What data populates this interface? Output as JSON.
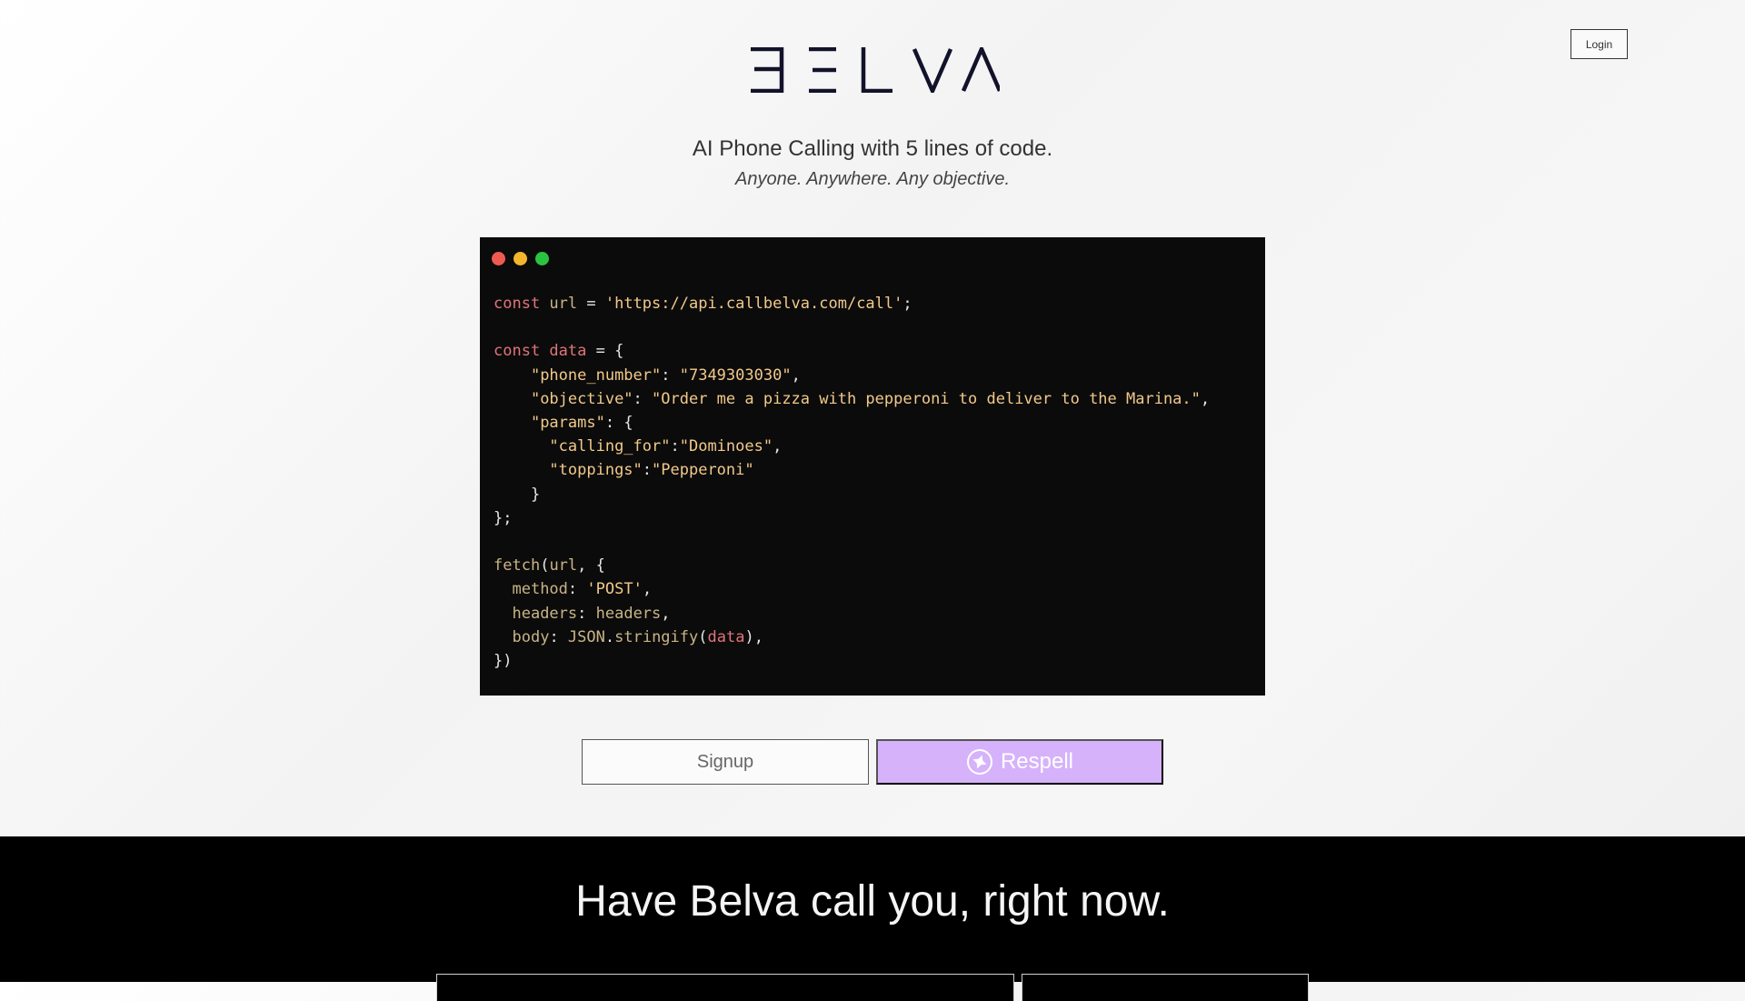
{
  "header": {
    "login_label": "Login",
    "brand": "BELVA"
  },
  "hero": {
    "tagline": "AI Phone Calling with 5 lines of code.",
    "subtagline": "Anyone. Anywhere. Any objective."
  },
  "code": {
    "lines": [
      [
        [
          "kw",
          "const "
        ],
        [
          "var",
          "url"
        ],
        [
          "pun",
          " = "
        ],
        [
          "str",
          "'https://api.callbelva.com/call'"
        ],
        [
          "pun",
          ";"
        ]
      ],
      [],
      [
        [
          "kw",
          "const "
        ],
        [
          "red",
          "data"
        ],
        [
          "pun",
          " = {"
        ]
      ],
      [
        [
          "pun",
          "    "
        ],
        [
          "str",
          "\"phone_number\""
        ],
        [
          "pun",
          ": "
        ],
        [
          "str",
          "\"7349303030\""
        ],
        [
          "pun",
          ","
        ]
      ],
      [
        [
          "pun",
          "    "
        ],
        [
          "str",
          "\"objective\""
        ],
        [
          "pun",
          ": "
        ],
        [
          "str",
          "\"Order me a pizza with pepperoni to deliver to the Marina.\""
        ],
        [
          "pun",
          ","
        ]
      ],
      [
        [
          "pun",
          "    "
        ],
        [
          "str",
          "\"params\""
        ],
        [
          "pun",
          ": {"
        ]
      ],
      [
        [
          "pun",
          "      "
        ],
        [
          "str",
          "\"calling_for\""
        ],
        [
          "pun",
          ":"
        ],
        [
          "str",
          "\"Dominoes\""
        ],
        [
          "pun",
          ","
        ]
      ],
      [
        [
          "pun",
          "      "
        ],
        [
          "str",
          "\"toppings\""
        ],
        [
          "pun",
          ":"
        ],
        [
          "str",
          "\"Pepperoni\""
        ]
      ],
      [
        [
          "pun",
          "    }"
        ]
      ],
      [
        [
          "pun",
          "};"
        ]
      ],
      [],
      [
        [
          "fn",
          "fetch"
        ],
        [
          "pun",
          "("
        ],
        [
          "var",
          "url"
        ],
        [
          "pun",
          ", {"
        ]
      ],
      [
        [
          "pun",
          "  "
        ],
        [
          "prop",
          "method"
        ],
        [
          "pun",
          ": "
        ],
        [
          "str",
          "'POST'"
        ],
        [
          "pun",
          ","
        ]
      ],
      [
        [
          "pun",
          "  "
        ],
        [
          "prop",
          "headers"
        ],
        [
          "pun",
          ": "
        ],
        [
          "var",
          "headers"
        ],
        [
          "pun",
          ","
        ]
      ],
      [
        [
          "pun",
          "  "
        ],
        [
          "prop",
          "body"
        ],
        [
          "pun",
          ": "
        ],
        [
          "var",
          "JSON"
        ],
        [
          "pun",
          "."
        ],
        [
          "fn",
          "stringify"
        ],
        [
          "pun",
          "("
        ],
        [
          "red",
          "data"
        ],
        [
          "pun",
          "),"
        ]
      ],
      [
        [
          "pun",
          "})"
        ]
      ]
    ]
  },
  "actions": {
    "signup_label": "Signup",
    "respell_label": "Respell"
  },
  "cta": {
    "heading": "Have Belva call you, right now."
  },
  "icons": {
    "window_dots": [
      "red-dot-icon",
      "yellow-dot-icon",
      "green-dot-icon"
    ],
    "respell": "respell-logo-icon"
  },
  "colors": {
    "respell_bg": "#d6b2fb",
    "code_bg": "#0b0b0b",
    "brand": "#12122a"
  }
}
